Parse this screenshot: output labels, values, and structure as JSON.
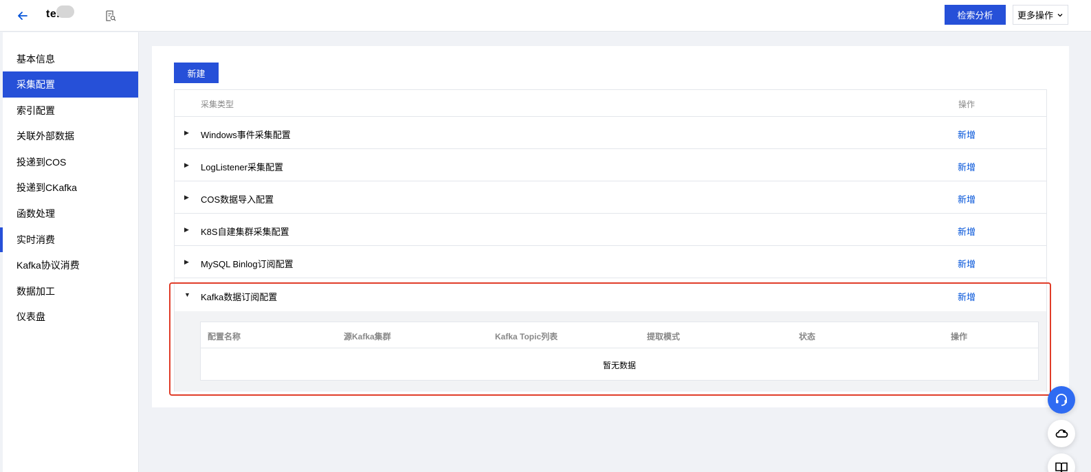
{
  "header": {
    "title": "te...",
    "search_analysis_label": "检索分析",
    "more_actions_label": "更多操作"
  },
  "sidebar": {
    "items": [
      {
        "label": "基本信息"
      },
      {
        "label": "采集配置"
      },
      {
        "label": "索引配置"
      },
      {
        "label": "关联外部数据"
      },
      {
        "label": "投递到COS"
      },
      {
        "label": "投递到CKafka"
      },
      {
        "label": "函数处理"
      },
      {
        "label": "实时消费"
      },
      {
        "label": "Kafka协议消费"
      },
      {
        "label": "数据加工"
      },
      {
        "label": "仪表盘"
      }
    ],
    "active_index": 1
  },
  "main": {
    "new_button_label": "新建",
    "table": {
      "columns": [
        "采集类型",
        "操作"
      ],
      "rows": [
        {
          "name": "Windows事件采集配置",
          "action": "新增"
        },
        {
          "name": "LogListener采集配置",
          "action": "新增"
        },
        {
          "name": "COS数据导入配置",
          "action": "新增"
        },
        {
          "name": "K8S自建集群采集配置",
          "action": "新增"
        },
        {
          "name": "MySQL Binlog订阅配置",
          "action": "新增"
        },
        {
          "name": "Kafka数据订阅配置",
          "action": "新增",
          "expanded": true
        }
      ]
    },
    "subtable": {
      "columns": [
        "配置名称",
        "源Kafka集群",
        "Kafka Topic列表",
        "提取模式",
        "状态",
        "操作"
      ],
      "empty_text": "暂无数据"
    }
  },
  "colors": {
    "primary": "#2650d8",
    "link": "#0052d9",
    "highlight_border": "#e03c28"
  },
  "icons": {
    "back": "arrow-left-icon",
    "doc": "document-search-icon",
    "caret_collapsed": "▶",
    "caret_expanded": "▼",
    "chevron": "chevron-down-icon"
  }
}
